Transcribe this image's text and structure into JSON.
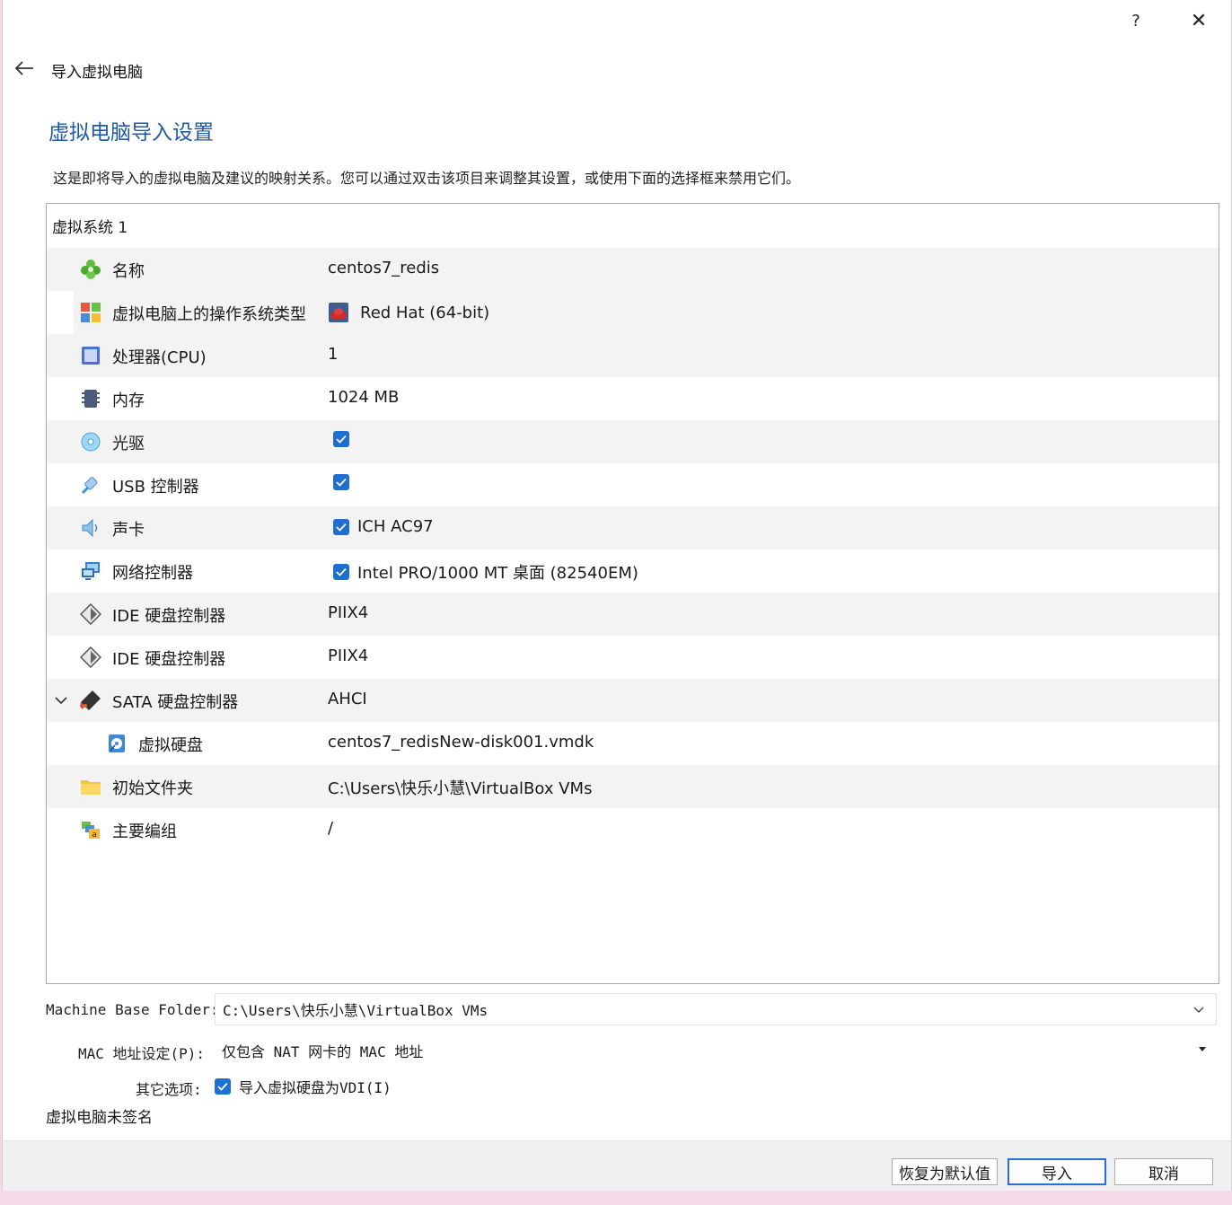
{
  "window": {
    "help_label": "?",
    "close_label": "✕",
    "wizard_title": "导入虚拟电脑"
  },
  "page": {
    "heading": "虚拟电脑导入设置",
    "description": "这是即将导入的虚拟电脑及建议的映射关系。您可以通过双击该项目来调整其设置，或使用下面的选择框来禁用它们。"
  },
  "tree": {
    "root_label": "虚拟系统 1",
    "rows": [
      {
        "icon": "name-icon",
        "label": "名称",
        "value": "centos7_redis"
      },
      {
        "icon": "os-type-icon",
        "label": "虚拟电脑上的操作系统类型",
        "value": "Red Hat (64-bit)",
        "value_icon": "red-hat-icon"
      },
      {
        "icon": "cpu-icon",
        "label": "处理器(CPU)",
        "value": "1"
      },
      {
        "icon": "memory-icon",
        "label": "内存",
        "value": "1024 MB"
      },
      {
        "icon": "optical-drive-icon",
        "label": "光驱",
        "checked": true,
        "value": ""
      },
      {
        "icon": "usb-icon",
        "label": "USB 控制器",
        "checked": true,
        "value": ""
      },
      {
        "icon": "sound-icon",
        "label": "声卡",
        "checked": true,
        "value": "ICH AC97"
      },
      {
        "icon": "network-icon",
        "label": "网络控制器",
        "checked": true,
        "value": "Intel PRO/1000 MT 桌面 (82540EM)"
      },
      {
        "icon": "ide-controller-icon",
        "label": "IDE 硬盘控制器",
        "value": "PIIX4"
      },
      {
        "icon": "ide-controller-icon",
        "label": "IDE 硬盘控制器",
        "value": "PIIX4"
      },
      {
        "icon": "sata-controller-icon",
        "label": "SATA 硬盘控制器",
        "value": "AHCI",
        "expanded": true
      },
      {
        "icon": "virtual-disk-icon",
        "label": "虚拟硬盘",
        "value": "centos7_redisNew-disk001.vmdk",
        "child": true
      },
      {
        "icon": "folder-icon",
        "label": "初始文件夹",
        "value": "C:\\Users\\快乐小慧\\VirtualBox VMs"
      },
      {
        "icon": "group-icon",
        "label": "主要编组",
        "value": "/"
      }
    ]
  },
  "form": {
    "base_folder_label": "Machine Base Folder:",
    "base_folder_value": "C:\\Users\\快乐小慧\\VirtualBox VMs",
    "mac_label": "MAC 地址设定(P):",
    "mac_value": "仅包含 NAT 网卡的 MAC 地址",
    "other_label": "其它选项:",
    "other_option": "导入虚拟硬盘为VDI(I)",
    "other_checked": true,
    "unsigned_text": "虚拟电脑未签名"
  },
  "buttons": {
    "restore_defaults": "恢复为默认值",
    "import": "导入",
    "cancel": "取消"
  },
  "colors": {
    "heading": "#1f5aa6",
    "checkbox": "#1f6fd1",
    "default_button_border": "#2a6fd6"
  }
}
